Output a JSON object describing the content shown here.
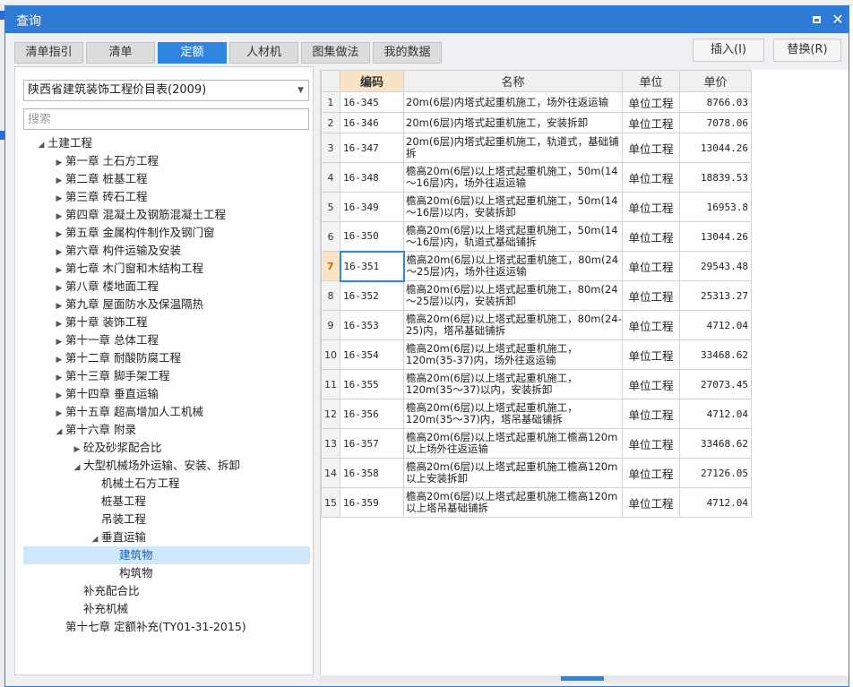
{
  "window": {
    "title": "查询"
  },
  "tabs": [
    {
      "label": "清单指引",
      "active": false
    },
    {
      "label": "清单",
      "active": false
    },
    {
      "label": "定额",
      "active": true
    },
    {
      "label": "人材机",
      "active": false
    },
    {
      "label": "图集做法",
      "active": false
    },
    {
      "label": "我的数据",
      "active": false
    }
  ],
  "buttons": {
    "insert": "插入(I)",
    "replace": "替换(R)"
  },
  "library_select": {
    "value": "陕西省建筑装饰工程价目表(2009)"
  },
  "search": {
    "placeholder": "搜索",
    "value": ""
  },
  "tree": [
    {
      "label": "土建工程",
      "arrow": "◢",
      "level": 0
    },
    {
      "label": "第一章 土石方工程",
      "arrow": "▶",
      "level": 1
    },
    {
      "label": "第二章 桩基工程",
      "arrow": "▶",
      "level": 1
    },
    {
      "label": "第三章 砖石工程",
      "arrow": "▶",
      "level": 1
    },
    {
      "label": "第四章 混凝土及钢筋混凝土工程",
      "arrow": "▶",
      "level": 1
    },
    {
      "label": "第五章 金属构件制作及钢门窗",
      "arrow": "▶",
      "level": 1
    },
    {
      "label": "第六章 构件运输及安装",
      "arrow": "▶",
      "level": 1
    },
    {
      "label": "第七章 木门窗和木结构工程",
      "arrow": "▶",
      "level": 1
    },
    {
      "label": "第八章 楼地面工程",
      "arrow": "▶",
      "level": 1
    },
    {
      "label": "第九章 屋面防水及保温隔热",
      "arrow": "▶",
      "level": 1
    },
    {
      "label": "第十章 装饰工程",
      "arrow": "▶",
      "level": 1
    },
    {
      "label": "第十一章 总体工程",
      "arrow": "▶",
      "level": 1
    },
    {
      "label": "第十二章 耐酸防腐工程",
      "arrow": "▶",
      "level": 1
    },
    {
      "label": "第十三章 脚手架工程",
      "arrow": "▶",
      "level": 1
    },
    {
      "label": "第十四章 垂直运输",
      "arrow": "▶",
      "level": 1
    },
    {
      "label": "第十五章 超高增加人工机械",
      "arrow": "▶",
      "level": 1
    },
    {
      "label": "第十六章 附录",
      "arrow": "◢",
      "level": 1
    },
    {
      "label": "砼及砂浆配合比",
      "arrow": "▶",
      "level": 2
    },
    {
      "label": "大型机械场外运输、安装、拆卸",
      "arrow": "◢",
      "level": 2
    },
    {
      "label": "机械土石方工程",
      "arrow": "",
      "level": 3
    },
    {
      "label": "桩基工程",
      "arrow": "",
      "level": 3
    },
    {
      "label": "吊装工程",
      "arrow": "",
      "level": 3
    },
    {
      "label": "垂直运输",
      "arrow": "◢",
      "level": 3
    },
    {
      "label": "建筑物",
      "arrow": "",
      "level": 4,
      "selected": true
    },
    {
      "label": "构筑物",
      "arrow": "",
      "level": 4
    },
    {
      "label": "补充配合比",
      "arrow": "",
      "level": 2
    },
    {
      "label": "补充机械",
      "arrow": "",
      "level": 2
    },
    {
      "label": "第十七章 定额补充(TY01-31-2015)",
      "arrow": "",
      "level": 1
    }
  ],
  "grid": {
    "headers": {
      "code": "编码",
      "name": "名称",
      "unit": "单位",
      "price": "单价"
    },
    "active_row": 7,
    "rows": [
      {
        "n": "1",
        "code": "16-345",
        "name": "20m(6层)内塔式起重机施工，场外往返运输",
        "unit": "单位工程",
        "price": "8766.03"
      },
      {
        "n": "2",
        "code": "16-346",
        "name": "20m(6层)内塔式起重机施工，安装拆卸",
        "unit": "单位工程",
        "price": "7078.06"
      },
      {
        "n": "3",
        "code": "16-347",
        "name": "20m(6层)内塔式起重机施工，轨道式，基础铺拆",
        "unit": "单位工程",
        "price": "13044.26"
      },
      {
        "n": "4",
        "code": "16-348",
        "name": "檐高20m(6层)以上塔式起重机施工，50m(14～16层)内，场外往返运输",
        "unit": "单位工程",
        "price": "18839.53"
      },
      {
        "n": "5",
        "code": "16-349",
        "name": "檐高20m(6层)以上塔式起重机施工，50m(14～16层)以内，安装拆卸",
        "unit": "单位工程",
        "price": "16953.8"
      },
      {
        "n": "6",
        "code": "16-350",
        "name": "檐高20m(6层)以上塔式起重机施工，50m(14～16层)内，轨道式基础铺拆",
        "unit": "单位工程",
        "price": "13044.26"
      },
      {
        "n": "7",
        "code": "16-351",
        "name": "檐高20m(6层)以上塔式起重机施工，80m(24～25层)内，场外往返运输",
        "unit": "单位工程",
        "price": "29543.48"
      },
      {
        "n": "8",
        "code": "16-352",
        "name": "檐高20m(6层)以上塔式起重机施工，80m(24～25层)以内，安装拆卸",
        "unit": "单位工程",
        "price": "25313.27"
      },
      {
        "n": "9",
        "code": "16-353",
        "name": "檐高20m(6层)以上塔式起重机施工，80m(24-25)内，塔吊基础铺拆",
        "unit": "单位工程",
        "price": "4712.04"
      },
      {
        "n": "10",
        "code": "16-354",
        "name": "檐高20m(6层)以上塔式起重机施工，120m(35-37)内，场外往返运输",
        "unit": "单位工程",
        "price": "33468.62"
      },
      {
        "n": "11",
        "code": "16-355",
        "name": "檐高20m(6层)以上塔式起重机施工，120m(35～37)以内，安装拆卸",
        "unit": "单位工程",
        "price": "27073.45"
      },
      {
        "n": "12",
        "code": "16-356",
        "name": "檐高20m(6层)以上塔式起重机施工，120m(35～37)内，塔吊基础铺拆",
        "unit": "单位工程",
        "price": "4712.04"
      },
      {
        "n": "13",
        "code": "16-357",
        "name": "檐高20m(6层)以上塔式起重机施工檐高120m以上场外往返运输",
        "unit": "单位工程",
        "price": "33468.62"
      },
      {
        "n": "14",
        "code": "16-358",
        "name": "檐高20m(6层)以上塔式起重机施工檐高120m以上安装拆卸",
        "unit": "单位工程",
        "price": "27126.05"
      },
      {
        "n": "15",
        "code": "16-359",
        "name": "檐高20m(6层)以上塔式起重机施工檐高120m以上塔吊基础铺拆",
        "unit": "单位工程",
        "price": "4712.04"
      }
    ]
  },
  "colors": {
    "titlebar": "#2f7bd6",
    "active_tab": "#2f86e0",
    "selected_row": "#cfe6fb",
    "code_header": "#f7e3c6"
  }
}
